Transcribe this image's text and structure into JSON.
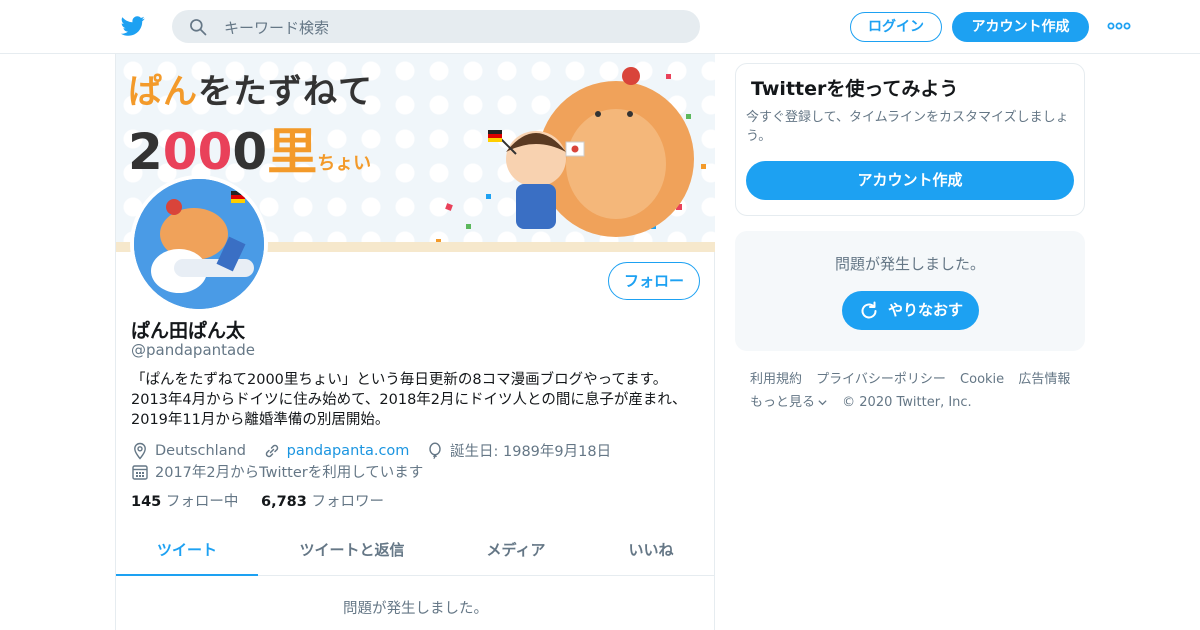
{
  "header": {
    "search_placeholder": "キーワード検索",
    "login_label": "ログイン",
    "signup_label": "アカウント作成"
  },
  "banner": {
    "title_line1_a": "ぱん",
    "title_line1_b": "をたずねて",
    "title_line2_a": "2",
    "title_line2_b": "00",
    "title_line2_c": "0",
    "title_line2_d": "里",
    "title_line2_e": "ちょい"
  },
  "profile": {
    "follow_label": "フォロー",
    "name": "ぱん田ぱん太",
    "handle": "@pandapantade",
    "bio_line1": "「ぱんをたずねて2000里ちょい」という毎日更新の8コマ漫画ブログやってます。",
    "bio_line2": "2013年4月からドイツに住み始めて、2018年2月にドイツ人との間に息子が産まれ、",
    "bio_line3": "2019年11月から離婚準備の別居開始。",
    "location": "Deutschland",
    "website": "pandapanta.com",
    "birthday": "誕生日: 1989年9月18日",
    "joined": "2017年2月からTwitterを利用しています",
    "following_count": "145",
    "following_label": "フォロー中",
    "followers_count": "6,783",
    "followers_label": "フォロワー"
  },
  "tabs": [
    {
      "label": "ツイート",
      "active": true
    },
    {
      "label": "ツイートと返信",
      "active": false
    },
    {
      "label": "メディア",
      "active": false
    },
    {
      "label": "いいね",
      "active": false
    }
  ],
  "main_error": "問題が発生しました。",
  "sidebar": {
    "card_title": "Twitterを使ってみよう",
    "card_text": "今すぐ登録して、タイムラインをカスタマイズしましょう。",
    "card_cta": "アカウント作成",
    "error_text": "問題が発生しました。",
    "retry_label": "やりなおす"
  },
  "footer": {
    "links": [
      "利用規約",
      "プライバシーポリシー",
      "Cookie",
      "広告情報",
      "もっと見る"
    ],
    "copyright": "© 2020 Twitter, Inc."
  },
  "colors": {
    "accent": "#1da1f2",
    "text_secondary": "#657786",
    "border": "#e6ecf0"
  },
  "icons": [
    "twitter-bird-icon",
    "search-icon",
    "more-dots-icon",
    "location-pin-icon",
    "link-icon",
    "balloon-icon",
    "calendar-icon",
    "refresh-icon",
    "chevron-down-icon"
  ]
}
